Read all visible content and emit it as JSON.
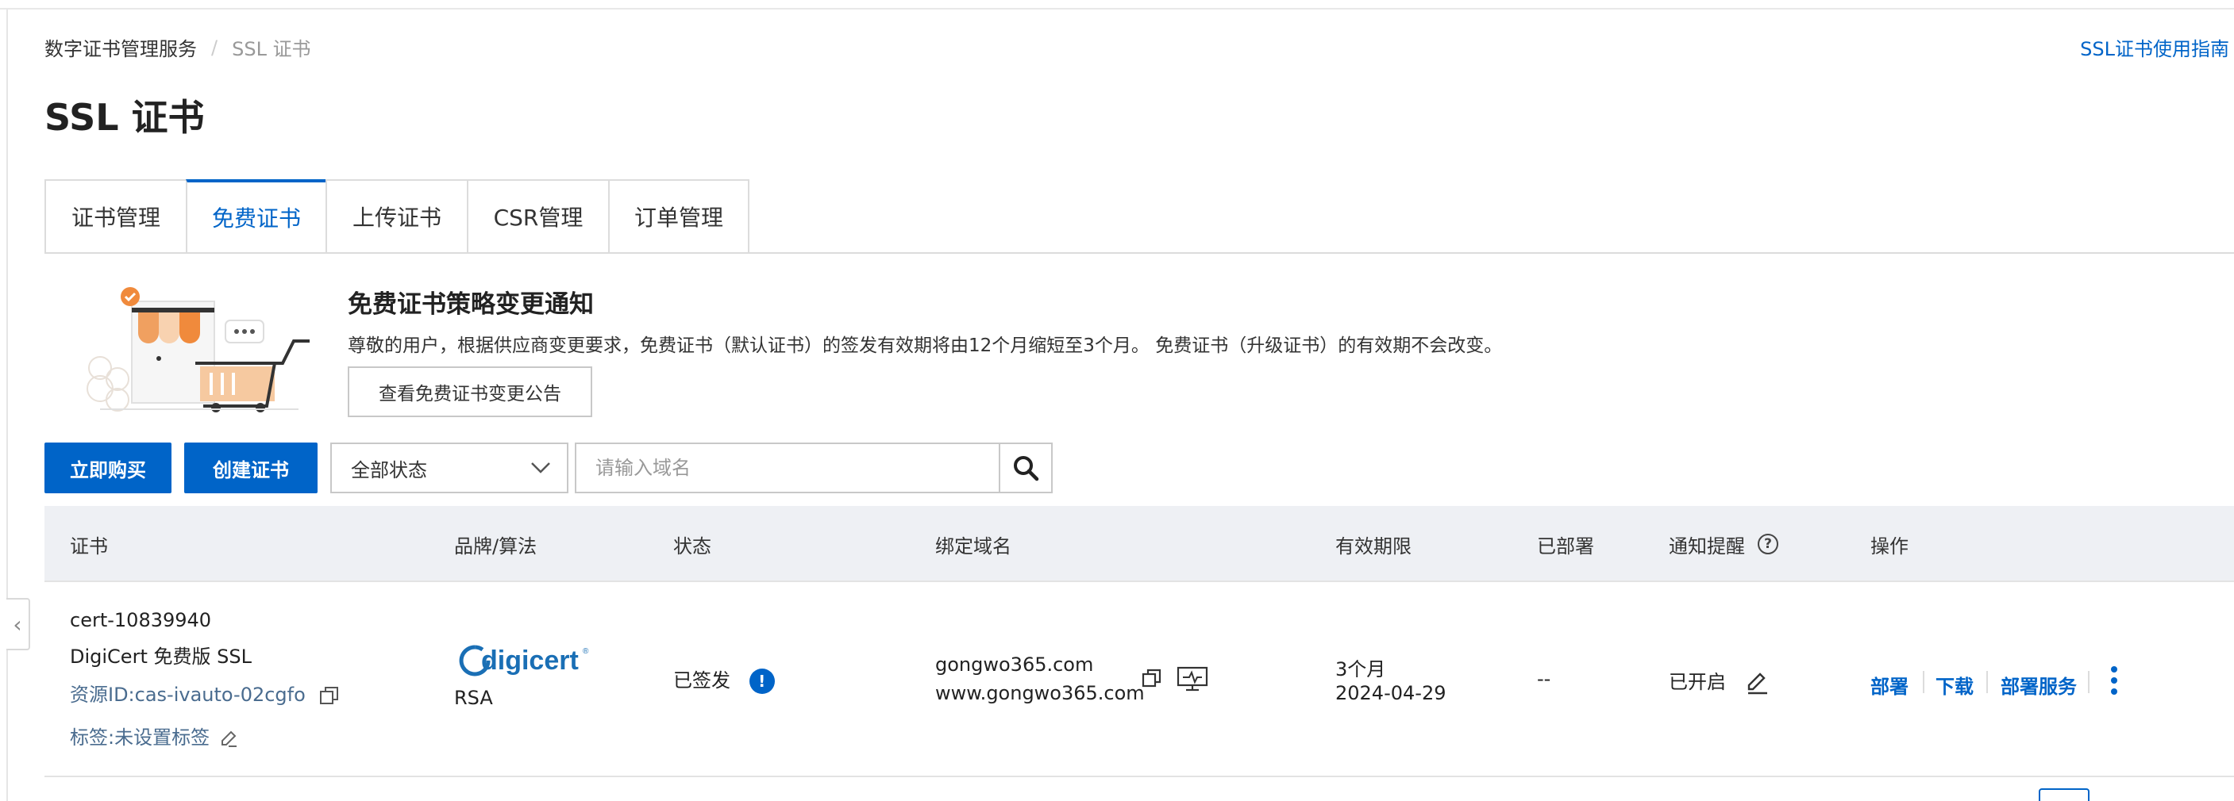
{
  "breadcrumb": {
    "root": "数字证书管理服务",
    "separator": "/",
    "current": "SSL 证书"
  },
  "guide_link": "SSL证书使用指南",
  "page_title": "SSL 证书",
  "tabs": [
    {
      "label": "证书管理",
      "active": false
    },
    {
      "label": "免费证书",
      "active": true
    },
    {
      "label": "上传证书",
      "active": false
    },
    {
      "label": "CSR管理",
      "active": false
    },
    {
      "label": "订单管理",
      "active": false
    }
  ],
  "notice": {
    "title": "免费证书策略变更通知",
    "text": "尊敬的用户，根据供应商变更要求，免费证书（默认证书）的签发有效期将由12个月缩短至3个月。 免费证书（升级证书）的有效期不会改变。",
    "button": "查看免费证书变更公告"
  },
  "toolbar": {
    "buy_label": "立即购买",
    "create_label": "创建证书",
    "status_filter": "全部状态",
    "search_placeholder": "请输入域名"
  },
  "table": {
    "headers": {
      "cert": "证书",
      "brand": "品牌/算法",
      "status": "状态",
      "domain": "绑定域名",
      "validity": "有效期限",
      "deployed": "已部署",
      "notify": "通知提醒",
      "actions": "操作"
    },
    "rows": [
      {
        "cert_id": "cert-10839940",
        "cert_name": "DigiCert 免费版 SSL",
        "resource_id": "资源ID:cas-ivauto-02cgfo",
        "tag": "标签:未设置标签",
        "brand_logo": "digicert",
        "algorithm": "RSA",
        "status": "已签发",
        "domains": [
          "gongwo365.com",
          "www.gongwo365.com"
        ],
        "validity_period": "3个月",
        "expiry": "2024-04-29",
        "deployed": "--",
        "notify": "已开启",
        "actions": [
          "部署",
          "下载",
          "部署服务"
        ]
      }
    ]
  },
  "colors": {
    "primary": "#0064c8",
    "header_bg": "#eef0f4",
    "illus_orange": "#f08a3c"
  }
}
